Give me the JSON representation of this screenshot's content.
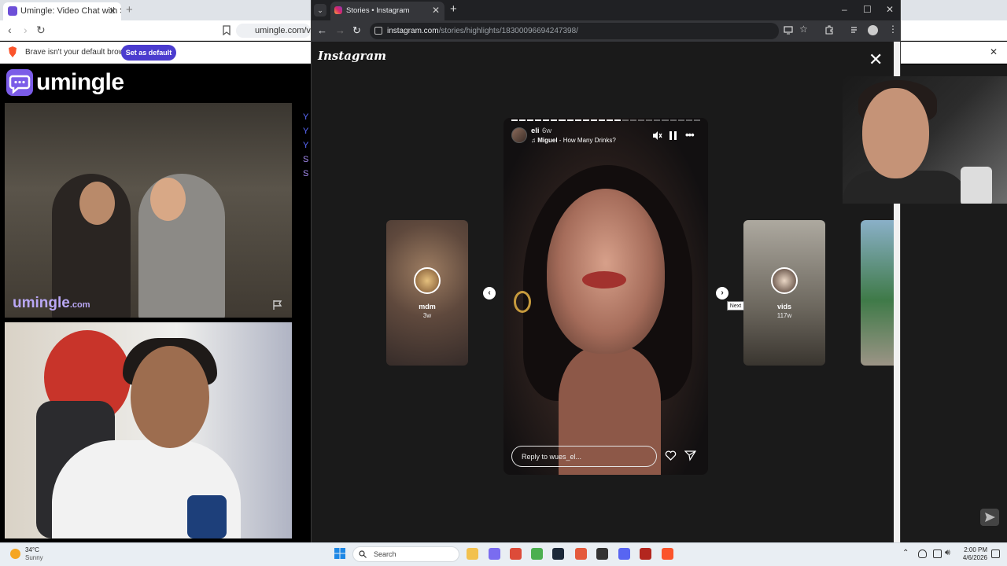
{
  "background_browser": {
    "tab_title": "Umingle: Video Chat with Stra",
    "url": "umingle.com/vide",
    "infobar_text": "Brave isn't your default browser",
    "set_default_label": "Set as default",
    "infobar_close": "✕",
    "brand": "umingle",
    "watermark": "umingle",
    "watermark_suffix": ".com",
    "chat_letters": [
      "Y",
      "Y",
      "Y",
      "S",
      "S"
    ]
  },
  "instagram_window": {
    "tab_title": "Stories • Instagram",
    "url_host": "instagram.com",
    "url_path": "/stories/highlights/18300096694247398/",
    "logo": "Instagram",
    "close": "✕",
    "story": {
      "username": "eli",
      "age": "6w",
      "music_artist": "Miguel",
      "music_title": " - How Many Drinks?",
      "reply_placeholder": "Reply to wues_el...",
      "progress_total": 24,
      "progress_done": 14
    },
    "prev_story": {
      "name": "mdm",
      "age": "3w"
    },
    "next_story": {
      "name": "vids",
      "age": "117w"
    },
    "next_tooltip": "Next",
    "prev_glyph": "‹",
    "next_glyph": "›",
    "more_glyph": "•••"
  },
  "taskbar": {
    "weather_temp": "34°C",
    "weather_desc": "Sunny",
    "search_placeholder": "Search",
    "time": "2:00 PM",
    "date": "4/6/2026",
    "apps": [
      {
        "name": "file-explorer",
        "color": "#f2c14e"
      },
      {
        "name": "copilot",
        "color": "#7a6cf0"
      },
      {
        "name": "chrome",
        "color": "#dd4b39"
      },
      {
        "name": "chrome-2",
        "color": "#4caf50"
      },
      {
        "name": "steam",
        "color": "#1b2838"
      },
      {
        "name": "chrome-3",
        "color": "#e45a3c"
      },
      {
        "name": "obs",
        "color": "#333333"
      },
      {
        "name": "discord",
        "color": "#5865f2"
      },
      {
        "name": "game-app",
        "color": "#b3261e"
      },
      {
        "name": "brave",
        "color": "#fb542b"
      }
    ]
  }
}
